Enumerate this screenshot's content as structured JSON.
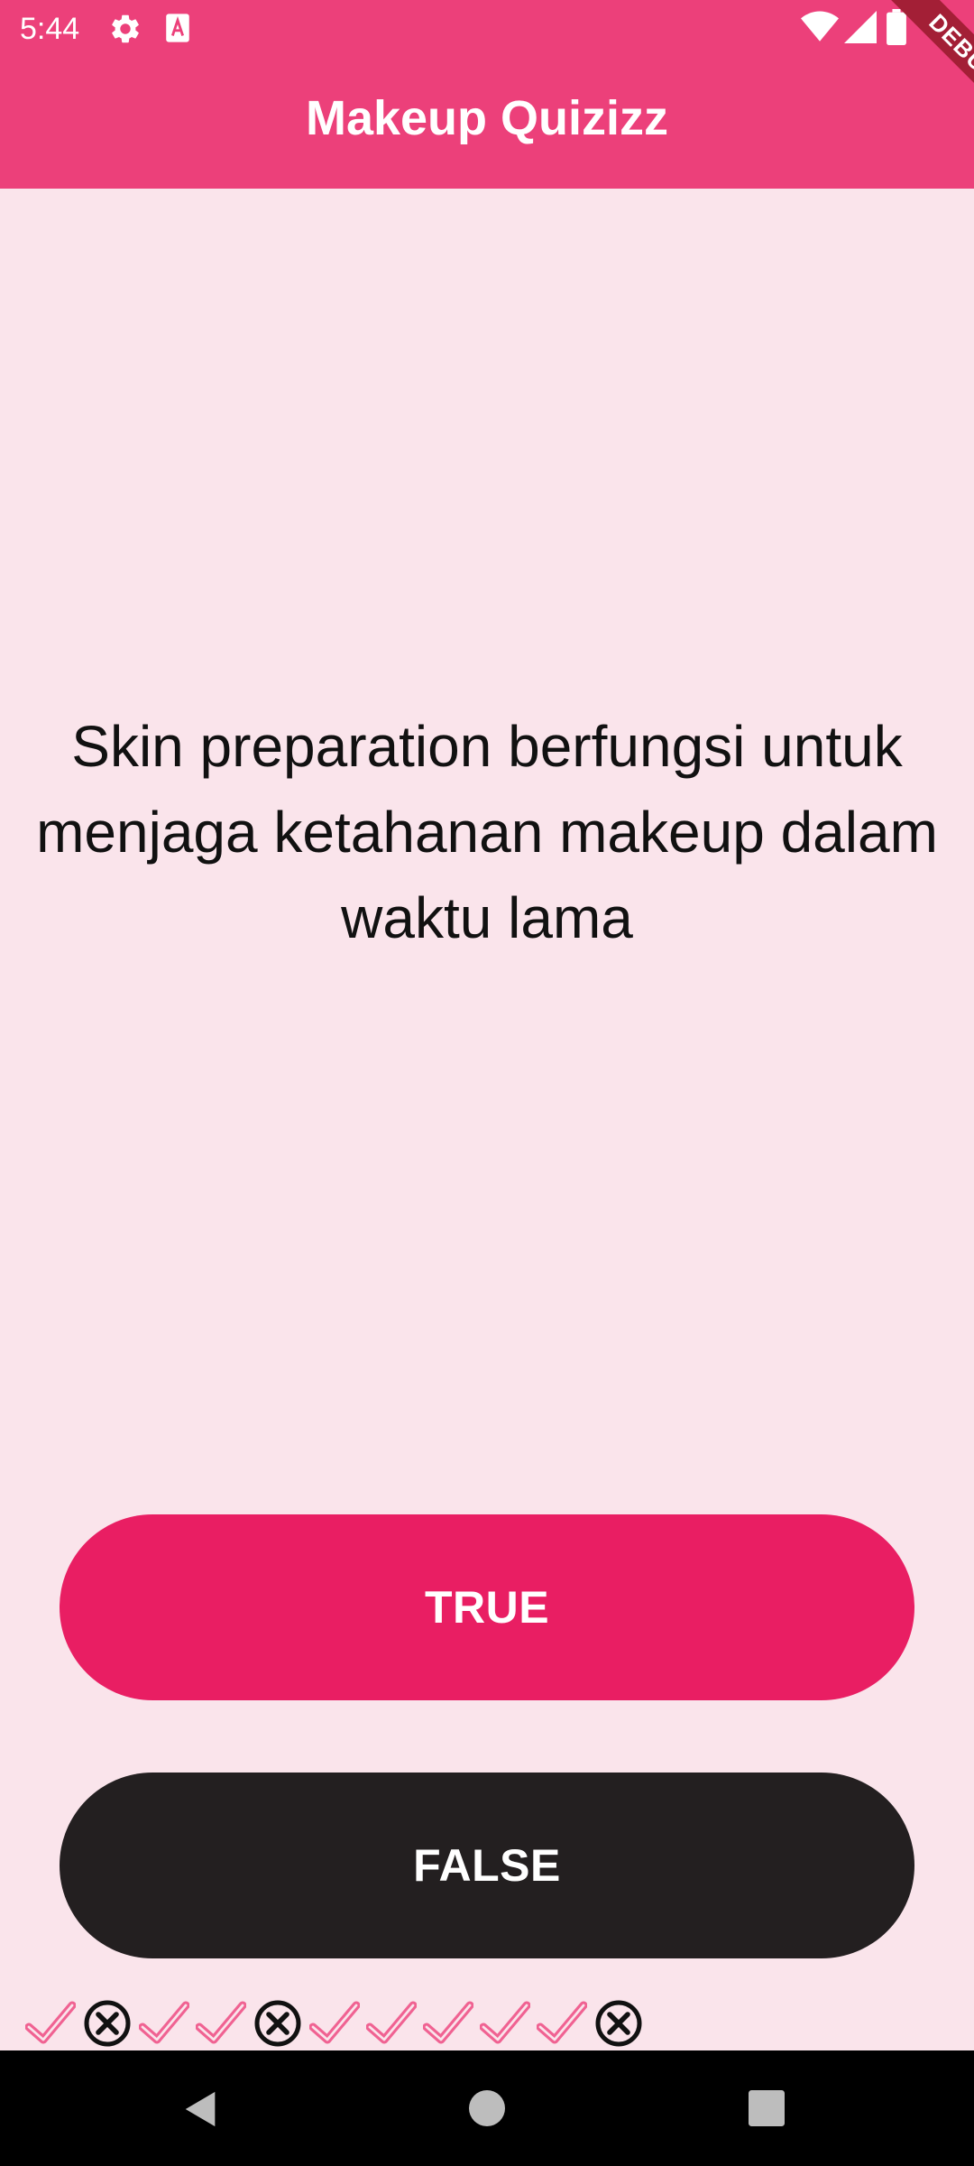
{
  "status_bar": {
    "time": "5:44",
    "icons": [
      "gear-icon",
      "sim-card-icon",
      "wifi-icon",
      "cell-signal-icon",
      "battery-icon"
    ]
  },
  "app_bar": {
    "title": "Makeup Quizizz",
    "color": "#EC407A"
  },
  "debug_banner": {
    "label": "DEBUG"
  },
  "question": {
    "text": "Skin preparation berfungsi untuk menjaga ketahanan makeup dalam waktu lama"
  },
  "buttons": {
    "true_label": "TRUE",
    "false_label": "FALSE",
    "true_color": "#E91E63",
    "false_color": "#231F20"
  },
  "score_keeper": {
    "results": [
      "correct",
      "wrong",
      "correct",
      "correct",
      "wrong",
      "correct",
      "correct",
      "correct",
      "correct",
      "correct",
      "wrong"
    ],
    "correct_icon": "check-icon",
    "wrong_icon": "cancel-circle-icon",
    "correct_color": "#F06292",
    "wrong_color": "#111111"
  },
  "nav_bar": {
    "icons": [
      "back-icon",
      "home-icon",
      "recents-icon"
    ]
  }
}
